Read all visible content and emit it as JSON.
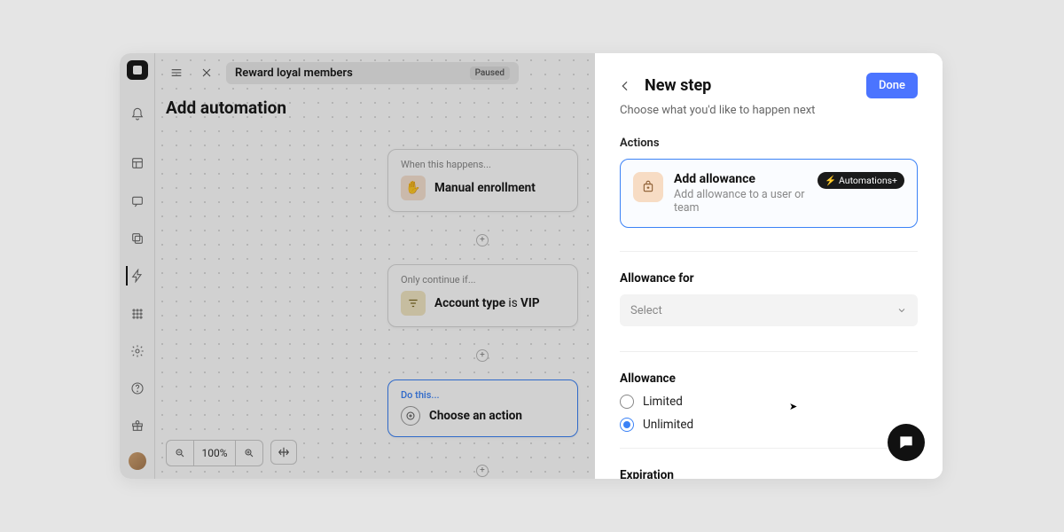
{
  "header": {
    "breadcrumb": "Reward loyal members",
    "status": "Paused",
    "page_title": "Add automation"
  },
  "flow": {
    "trigger_label": "When this happens...",
    "trigger_title": "Manual enrollment",
    "condition_label": "Only continue if...",
    "condition_field": "Account type",
    "condition_verb": "is",
    "condition_value": "VIP",
    "action_label": "Do this...",
    "action_title": "Choose an action"
  },
  "zoom": {
    "level": "100%"
  },
  "panel": {
    "title": "New step",
    "subtitle": "Choose what you'd like to happen next",
    "done_label": "Done",
    "actions_label": "Actions",
    "card": {
      "title": "Add allowance",
      "desc": "Add allowance to a user or team",
      "badge": "Automations+"
    },
    "allowance_for": {
      "label": "Allowance for",
      "placeholder": "Select"
    },
    "allowance": {
      "label": "Allowance",
      "option_limited": "Limited",
      "option_unlimited": "Unlimited",
      "selected": "unlimited"
    },
    "expiration_label": "Expiration"
  }
}
